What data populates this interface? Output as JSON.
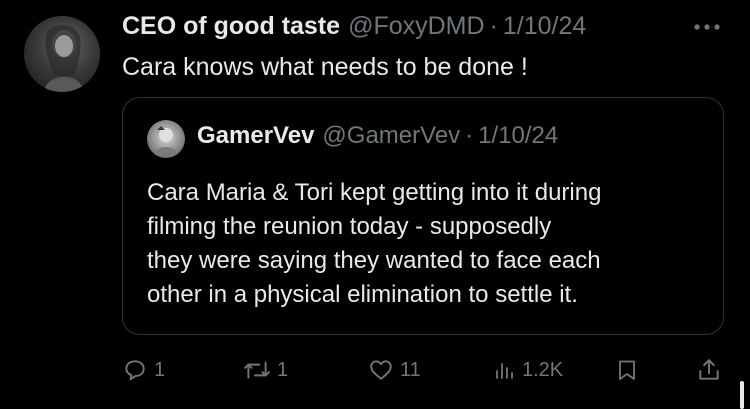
{
  "author": {
    "display_name": "CEO of good taste",
    "handle": "@FoxyDMD",
    "separator": "·",
    "date": "1/10/24"
  },
  "tweet_text": "Cara knows what needs to be done !",
  "quoted": {
    "display_name": "GamerVev",
    "handle": "@GamerVev",
    "separator": "·",
    "date": "1/10/24",
    "lines": [
      "Cara Maria & Tori kept getting into it during",
      "filming the reunion today - supposedly",
      "they were saying they wanted to face each",
      "other in a physical elimination to settle it."
    ]
  },
  "actions": {
    "replies": "1",
    "reposts": "1",
    "likes": "11",
    "views": "1.2K"
  },
  "icons": [
    "more-icon",
    "reply-icon",
    "repost-icon",
    "like-icon",
    "views-icon",
    "bookmark-icon",
    "share-icon"
  ],
  "colors": {
    "background": "#000000",
    "primary_text": "#e7e9ea",
    "secondary_text": "#71767b",
    "border": "#2f3336"
  }
}
